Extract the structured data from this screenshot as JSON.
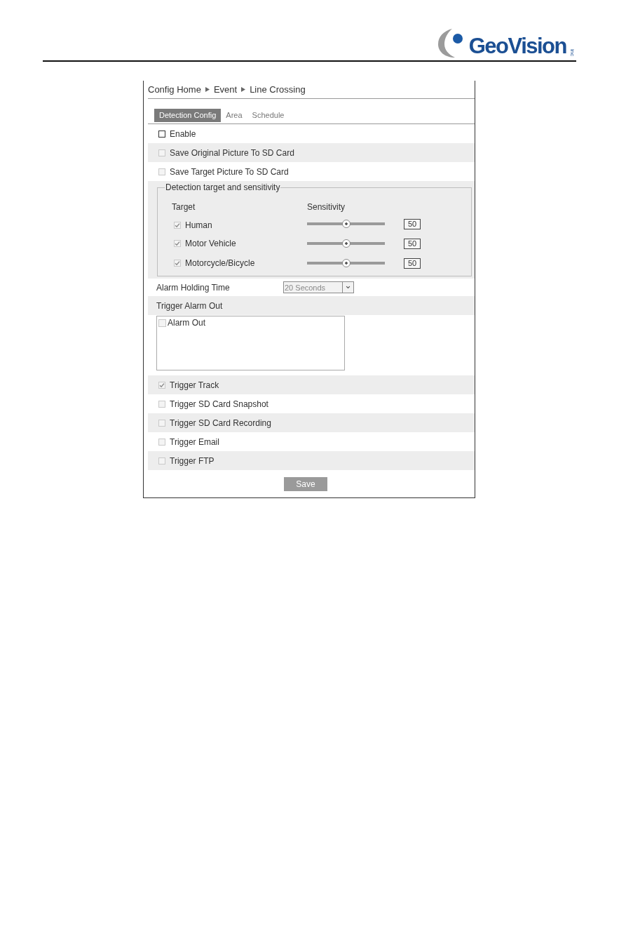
{
  "header": {
    "logo": {
      "wordmark": "GeoVision",
      "suffix": "inc"
    }
  },
  "breadcrumb": [
    "Config Home",
    "Event",
    "Line Crossing"
  ],
  "tabs": [
    {
      "label": "Detection Config",
      "selected": true
    },
    {
      "label": "Area",
      "selected": false
    },
    {
      "label": "Schedule",
      "selected": false
    }
  ],
  "form": {
    "rows": [
      {
        "kind": "checkbox",
        "label": "Enable",
        "checked": false,
        "disabled": false
      },
      {
        "kind": "checkbox",
        "label": "Save Original Picture To SD Card",
        "checked": false,
        "disabled": true
      },
      {
        "kind": "checkbox",
        "label": "Save Target Picture To SD Card",
        "checked": false,
        "disabled": true
      },
      {
        "kind": "group",
        "legend": "Detection target and sensitivity",
        "columns": [
          "Target",
          "Sensitivity"
        ],
        "targets": [
          {
            "label": "Human",
            "checked": true,
            "disabled": true,
            "level": 0.5,
            "value": "50"
          },
          {
            "label": "Motor Vehicle",
            "checked": true,
            "disabled": true,
            "level": 0.5,
            "value": "50"
          },
          {
            "label": "Motorcycle/Bicycle",
            "checked": true,
            "disabled": true,
            "level": 0.5,
            "value": "50"
          }
        ]
      },
      {
        "kind": "select",
        "label": "Alarm Holding Time",
        "value": "20 Seconds",
        "disabled": true
      },
      {
        "kind": "heading",
        "label": "Trigger Alarm Out"
      },
      {
        "kind": "list",
        "items": [
          {
            "label": "Alarm Out",
            "checked": false,
            "disabled": true
          }
        ]
      },
      {
        "kind": "checkbox",
        "label": "Trigger Track",
        "checked": true,
        "disabled": true
      },
      {
        "kind": "checkbox",
        "label": "Trigger SD Card Snapshot",
        "checked": false,
        "disabled": true
      },
      {
        "kind": "checkbox",
        "label": "Trigger SD Card Recording",
        "checked": false,
        "disabled": true
      },
      {
        "kind": "checkbox",
        "label": "Trigger Email",
        "checked": false,
        "disabled": true
      },
      {
        "kind": "checkbox",
        "label": "Trigger FTP",
        "checked": false,
        "disabled": true
      }
    ]
  },
  "save_button": {
    "label": "Save"
  }
}
